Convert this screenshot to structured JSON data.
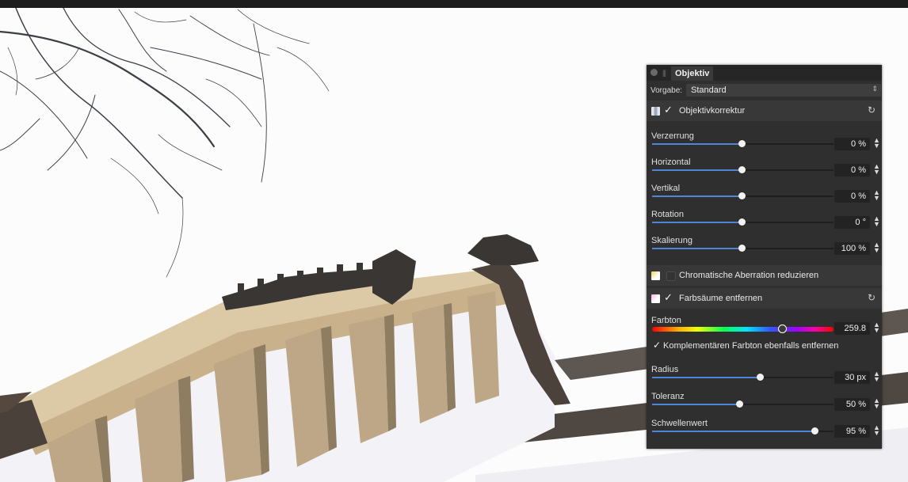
{
  "panel": {
    "tab_title": "Objektiv",
    "preset_label": "Vorgabe:",
    "preset_value": "Standard",
    "sections": [
      {
        "label": "Objektivkorrektur",
        "checked": true,
        "icon": "lens-distortion-icon",
        "params": [
          {
            "label": "Verzerrung",
            "value": "0 %",
            "position": 0.5
          },
          {
            "label": "Horizontal",
            "value": "0 %",
            "position": 0.5
          },
          {
            "label": "Vertikal",
            "value": "0 %",
            "position": 0.5
          },
          {
            "label": "Rotation",
            "value": "0 °",
            "position": 0.5
          },
          {
            "label": "Skalierung",
            "value": "100 %",
            "position": 0.5
          }
        ]
      },
      {
        "label": "Chromatische Aberration reduzieren",
        "checked": false,
        "icon": "chromatic-aberration-icon"
      },
      {
        "label": "Farbsäume entfernen",
        "checked": true,
        "icon": "defringe-icon",
        "hue": {
          "label": "Farbton",
          "value": "259.8",
          "position": 0.72
        },
        "complementary_label": "Komplementären Farbton ebenfalls entfernen",
        "params": [
          {
            "label": "Radius",
            "value": "30 px",
            "position": 0.6
          },
          {
            "label": "Toleranz",
            "value": "50 %",
            "position": 0.5
          },
          {
            "label": "Schwellenwert",
            "value": "95 %",
            "position": 0.95
          }
        ]
      }
    ]
  },
  "colors": {
    "panel_bg": "#2f2f2f",
    "slider_accent": "#4f86d8"
  }
}
